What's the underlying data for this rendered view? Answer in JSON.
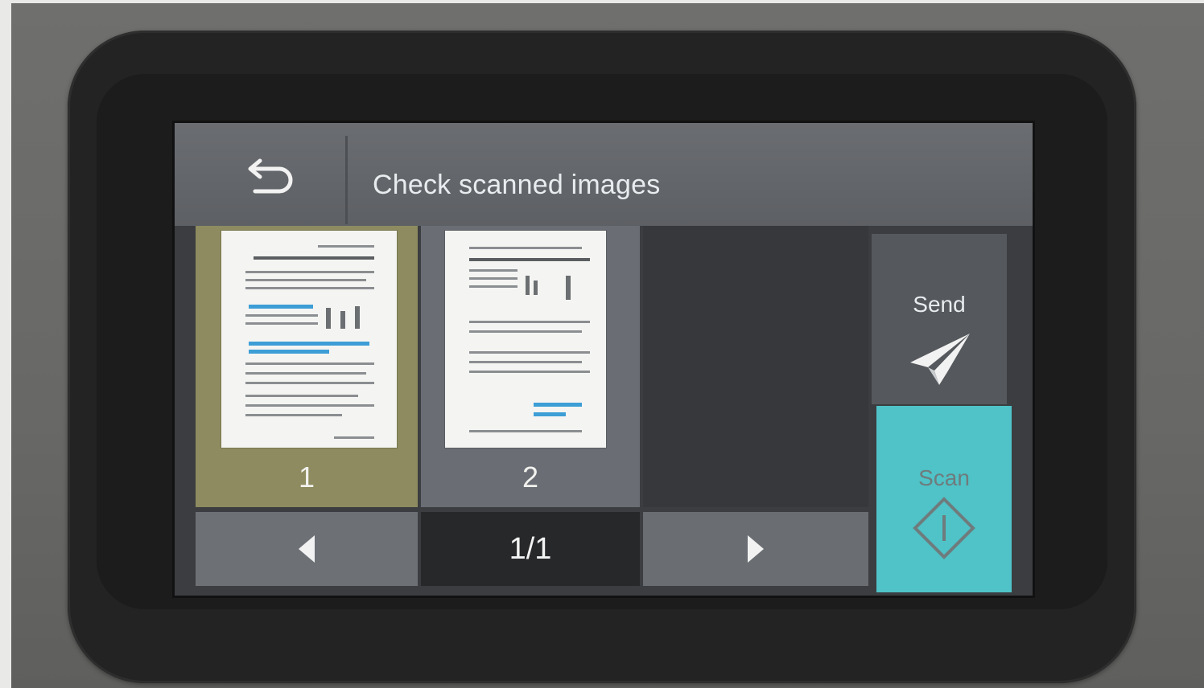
{
  "header": {
    "title": "Check scanned images",
    "back_icon": "back-arrow-icon"
  },
  "thumbnails": [
    {
      "label": "1",
      "selected": true
    },
    {
      "label": "2",
      "selected": false
    }
  ],
  "pager": {
    "count": "1/1",
    "prev_icon": "chevron-left-icon",
    "next_icon": "chevron-right-icon"
  },
  "actions": {
    "send_label": "Send",
    "send_icon": "paper-plane-icon",
    "scan_label": "Scan",
    "scan_icon": "start-diamond-icon"
  },
  "colors": {
    "selected_thumb": "#8d8b5f",
    "scan_button": "#4fc3c7",
    "screen_bg": "#3b3d40"
  }
}
